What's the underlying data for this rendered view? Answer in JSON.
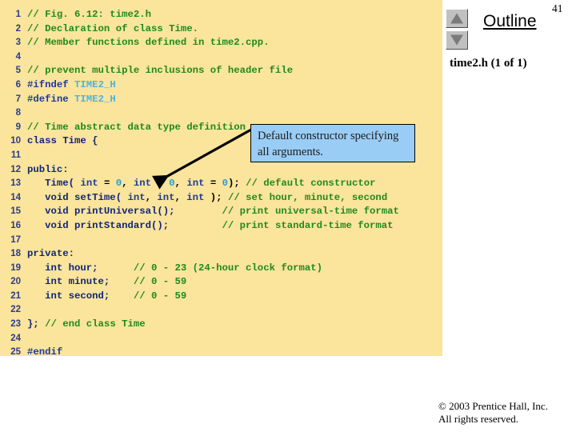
{
  "page": {
    "number": "41",
    "background_color": "#ffffff"
  },
  "code_panel": {
    "background_color": "#fbe49b",
    "line_number_color": "#2b3c8c",
    "comment_color": "#1f8a1f",
    "keyword_color": "#1a3a9e",
    "macro_color": "#4fb3dd",
    "number_color": "#1f9fe0",
    "lines": [
      {
        "n": "1",
        "tokens": [
          {
            "t": "// Fig. 6.12: time2.h",
            "c": "tok-cmt"
          }
        ]
      },
      {
        "n": "2",
        "tokens": [
          {
            "t": "// Declaration of class Time.",
            "c": "tok-cmt"
          }
        ]
      },
      {
        "n": "3",
        "tokens": [
          {
            "t": "// Member functions defined in time2.cpp.",
            "c": "tok-cmt"
          }
        ]
      },
      {
        "n": "4",
        "tokens": []
      },
      {
        "n": "5",
        "tokens": [
          {
            "t": "// prevent multiple inclusions of header file",
            "c": "tok-cmt"
          }
        ]
      },
      {
        "n": "6",
        "tokens": [
          {
            "t": "#ifndef ",
            "c": "tok-pp"
          },
          {
            "t": "TIME2_H",
            "c": "tok-mac"
          }
        ]
      },
      {
        "n": "7",
        "tokens": [
          {
            "t": "#define ",
            "c": "tok-pp"
          },
          {
            "t": "TIME2_H",
            "c": "tok-mac"
          }
        ]
      },
      {
        "n": "8",
        "tokens": []
      },
      {
        "n": "9",
        "tokens": [
          {
            "t": "// Time abstract data type definition",
            "c": "tok-cmt"
          }
        ]
      },
      {
        "n": "10",
        "tokens": [
          {
            "t": "class Time {",
            "c": "tok-id"
          }
        ]
      },
      {
        "n": "11",
        "tokens": []
      },
      {
        "n": "12",
        "tokens": [
          {
            "t": "public:",
            "c": "tok-id"
          }
        ]
      },
      {
        "n": "13",
        "tokens": [
          {
            "t": "   Time(",
            "c": "tok-id"
          },
          {
            "t": " ",
            "c": "tok-pun"
          },
          {
            "t": "int",
            "c": "tok-kw"
          },
          {
            "t": " = ",
            "c": "tok-pun"
          },
          {
            "t": "0",
            "c": "tok-num"
          },
          {
            "t": ", ",
            "c": "tok-pun"
          },
          {
            "t": "int",
            "c": "tok-kw"
          },
          {
            "t": " = ",
            "c": "tok-pun"
          },
          {
            "t": "0",
            "c": "tok-num"
          },
          {
            "t": ", ",
            "c": "tok-pun"
          },
          {
            "t": "int",
            "c": "tok-kw"
          },
          {
            "t": " = ",
            "c": "tok-pun"
          },
          {
            "t": "0",
            "c": "tok-num"
          },
          {
            "t": "); ",
            "c": "tok-pun"
          },
          {
            "t": "// default constructor",
            "c": "tok-cmt"
          }
        ]
      },
      {
        "n": "14",
        "tokens": [
          {
            "t": "   void setTime(",
            "c": "tok-id"
          },
          {
            "t": " ",
            "c": "tok-pun"
          },
          {
            "t": "int",
            "c": "tok-kw"
          },
          {
            "t": ", ",
            "c": "tok-pun"
          },
          {
            "t": "int",
            "c": "tok-kw"
          },
          {
            "t": ", ",
            "c": "tok-pun"
          },
          {
            "t": "int",
            "c": "tok-kw"
          },
          {
            "t": " ); ",
            "c": "tok-pun"
          },
          {
            "t": "// set hour, minute, second",
            "c": "tok-cmt"
          }
        ]
      },
      {
        "n": "15",
        "tokens": [
          {
            "t": "   void printUniversal();",
            "c": "tok-id"
          },
          {
            "t": "        ",
            "c": "tok-pun"
          },
          {
            "t": "// print universal-time format",
            "c": "tok-cmt"
          }
        ]
      },
      {
        "n": "16",
        "tokens": [
          {
            "t": "   void printStandard();",
            "c": "tok-id"
          },
          {
            "t": "         ",
            "c": "tok-pun"
          },
          {
            "t": "// print standard-time format",
            "c": "tok-cmt"
          }
        ]
      },
      {
        "n": "17",
        "tokens": []
      },
      {
        "n": "18",
        "tokens": [
          {
            "t": "private:",
            "c": "tok-id"
          }
        ]
      },
      {
        "n": "19",
        "tokens": [
          {
            "t": "   int hour;",
            "c": "tok-id"
          },
          {
            "t": "      ",
            "c": "tok-pun"
          },
          {
            "t": "// 0 - 23 (24-hour clock format)",
            "c": "tok-cmt"
          }
        ]
      },
      {
        "n": "20",
        "tokens": [
          {
            "t": "   int minute;",
            "c": "tok-id"
          },
          {
            "t": "    ",
            "c": "tok-pun"
          },
          {
            "t": "// 0 - 59",
            "c": "tok-cmt"
          }
        ]
      },
      {
        "n": "21",
        "tokens": [
          {
            "t": "   int second;",
            "c": "tok-id"
          },
          {
            "t": "    ",
            "c": "tok-pun"
          },
          {
            "t": "// 0 - 59",
            "c": "tok-cmt"
          }
        ]
      },
      {
        "n": "22",
        "tokens": []
      },
      {
        "n": "23",
        "tokens": [
          {
            "t": "}; ",
            "c": "tok-id"
          },
          {
            "t": "// end class Time",
            "c": "tok-cmt"
          }
        ]
      },
      {
        "n": "24",
        "tokens": []
      },
      {
        "n": "25",
        "tokens": [
          {
            "t": "#endif",
            "c": "tok-pp"
          }
        ]
      }
    ]
  },
  "callout": {
    "text": "Default constructor specifying all arguments.",
    "background_color": "#9acdf5",
    "border_color": "#000000",
    "target_line": "13"
  },
  "outline": {
    "title": "Outline",
    "file_label": "time2.h (1 of 1)",
    "nav_up_icon": "triangle-up-icon",
    "nav_down_icon": "triangle-down-icon"
  },
  "footer": {
    "line1": "© 2003 Prentice Hall, Inc.",
    "line2": "All rights reserved."
  }
}
